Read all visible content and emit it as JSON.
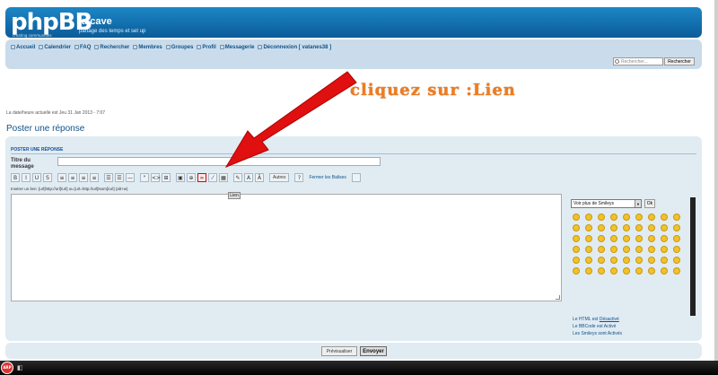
{
  "header": {
    "logo": "phpBB",
    "logo_tagline": "creating communities",
    "site_title": "la cave",
    "site_description": "partage des temps et set up"
  },
  "nav": {
    "items": [
      {
        "label": "Accueil",
        "icon": "home-icon"
      },
      {
        "label": "Calendrier",
        "icon": "calendar-icon"
      },
      {
        "label": "FAQ",
        "icon": "help-icon"
      },
      {
        "label": "Rechercher",
        "icon": "search-icon"
      },
      {
        "label": "Membres",
        "icon": "members-icon"
      },
      {
        "label": "Groupes",
        "icon": "groups-icon"
      },
      {
        "label": "Profil",
        "icon": "profile-icon"
      },
      {
        "label": "Messagerie",
        "icon": "mail-icon"
      },
      {
        "label": "Déconnexion [ vatanes38 ]",
        "icon": "logout-icon"
      }
    ],
    "search_placeholder": "Rechercher...",
    "search_button": "Rechercher"
  },
  "annotation": {
    "text": "cliquez sur :Lien",
    "color": "#f07b1e",
    "arrow_color": "#e01010"
  },
  "datetime": "La date/heure actuelle est Jeu 31 Jan 2013 - 7:07",
  "page_title": "Poster une réponse",
  "form": {
    "section_title": "POSTER UNE RÉPONSE",
    "subject_label": "Titre du message",
    "subject_value": "",
    "toolbar": [
      "B",
      "I",
      "U",
      "S",
      "≡",
      "≡",
      "≡",
      "≡",
      "☰",
      "☰",
      "—",
      "\"",
      "<>",
      "⊞",
      "▣",
      "⊕",
      "∞",
      "⁄",
      "▦",
      "✎",
      "A",
      "Ā"
    ],
    "toolbar_more": "Autres",
    "toolbar_help": "?",
    "toolbar_close_tags": "Fermer les Balises",
    "help_line": "Insérer un lien: [url]http://url[/url] ou [url=http://url]Nom[/url] (alt+w)",
    "tooltip": "Lien",
    "message_value": ""
  },
  "smileys": {
    "select_label": "Voir plus de Smileys",
    "ok_label": "Ok",
    "status_html_prefix": "Le HTML est ",
    "status_html_value": "Désactivé",
    "status_bbcode": "Le BBCode est Activé",
    "status_smileys": "Les Smileys sont Activés"
  },
  "buttons": {
    "preview": "Prévisualiser",
    "submit": "Envoyer"
  },
  "taskbar": {
    "start_label": "ARP"
  }
}
